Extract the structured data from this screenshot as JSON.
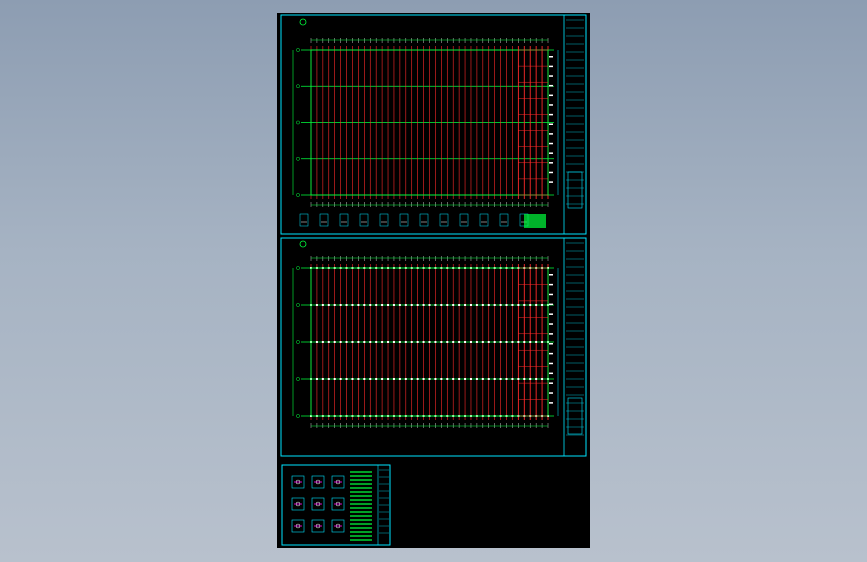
{
  "viewport": {
    "background_top": "#8d9db2",
    "background_bottom": "#b8c1cd"
  },
  "drawing": {
    "paper_color": "#000000",
    "frame_color": "#00e5ff",
    "grid_color": "#ff2a2a",
    "axis_color": "#00ff3c",
    "bay_count_sheet1": 40,
    "row_count_sheet1": 5,
    "bay_count_sheet2": 40,
    "row_count_sheet2": 5,
    "detail_count": 9
  }
}
